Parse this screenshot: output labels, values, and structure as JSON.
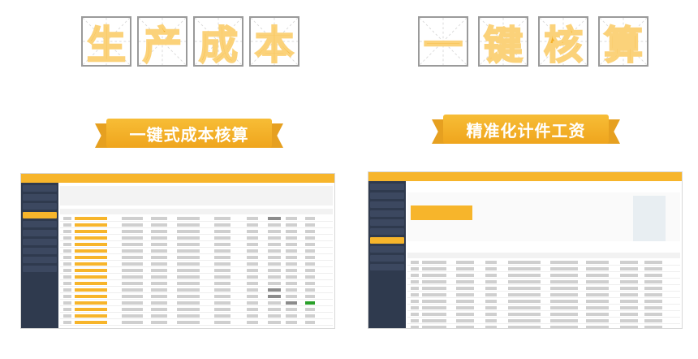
{
  "title_left": [
    "生",
    "产",
    "成",
    "本"
  ],
  "title_right": [
    "一",
    "键",
    "核",
    "算"
  ],
  "ribbon_left": "一键式成本核算",
  "ribbon_right": "精准化计件工资",
  "colors": {
    "accent": "#f5b028",
    "sidebar": "#2f3a4e",
    "green": "#2aa02a"
  },
  "left_screenshot": {
    "rows": 17
  },
  "right_screenshot": {
    "rows": 11
  }
}
